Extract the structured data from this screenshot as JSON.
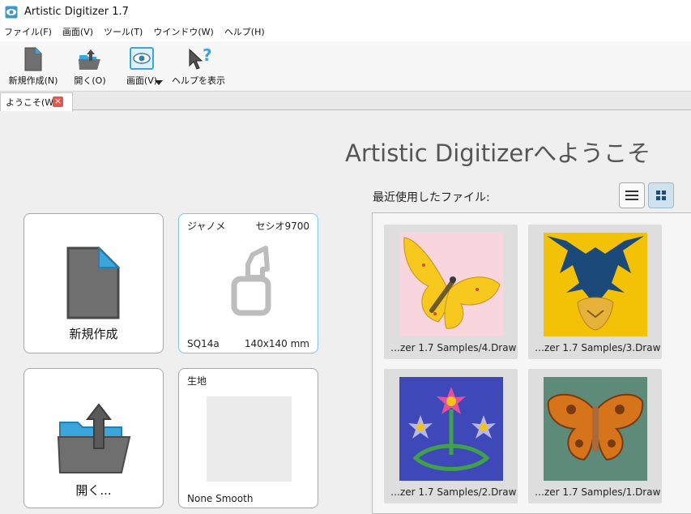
{
  "window": {
    "title": "Artistic Digitizer 1.7"
  },
  "menu": [
    "ファイル(F)",
    "画面(V)",
    "ツール(T)",
    "ウインドウ(W)",
    "ヘルプ(H)"
  ],
  "toolbar": {
    "new_label": "新規作成(N)",
    "open_label": "開く(O)",
    "view_label": "画面(V)",
    "help_label": "ヘルプを表示"
  },
  "tab": {
    "label": "ようこそ(W)"
  },
  "welcome": {
    "heading": "Artistic Digitizerへようこそ",
    "recent_label": "最近使用したファイル:"
  },
  "cards": {
    "new": {
      "label": "新規作成"
    },
    "open": {
      "label": "開く..."
    },
    "hoop": {
      "brand": "ジャノメ",
      "model": "セシオ9700",
      "hoop_name": "SQ14a",
      "size": "140x140 mm"
    },
    "fabric": {
      "title": "生地",
      "name": "None Smooth"
    }
  },
  "recent_files": [
    {
      "caption": "…zer 1.7 Samples/4.Draw",
      "icon": "butterfly-yellow"
    },
    {
      "caption": "…zer 1.7 Samples/3.Draw",
      "icon": "tiger-tribal"
    },
    {
      "caption": "…zer 1.7 Samples/2.Draw",
      "icon": "flowers-celtic"
    },
    {
      "caption": "…zer 1.7 Samples/1.Draw",
      "icon": "moth-orange"
    }
  ],
  "colors": {
    "accent": "#3aa6dc",
    "viewActive": "#cfe2ef",
    "close": "#e0584d"
  }
}
